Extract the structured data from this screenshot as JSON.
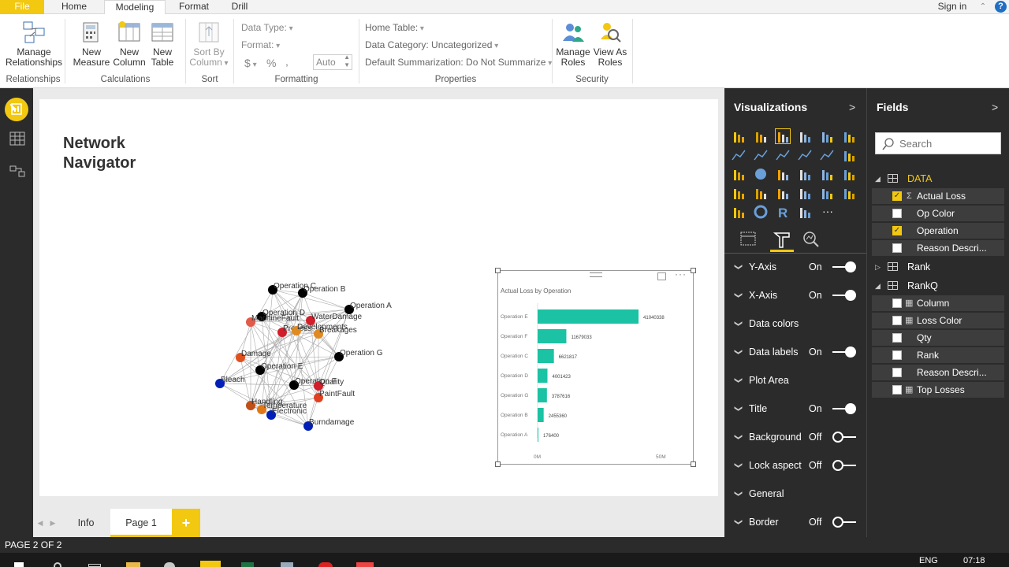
{
  "ribbon": {
    "tabs": [
      "File",
      "Home",
      "Modeling",
      "Format",
      "Drill"
    ],
    "signin": "Sign in",
    "help": "?",
    "buttons": {
      "manage_rel": "Manage Relationships",
      "new_measure": "New Measure",
      "new_column": "New Column",
      "new_table": "New Table",
      "sort_by_column": "Sort By Column",
      "manage_roles": "Manage Roles",
      "view_as_roles": "View As Roles"
    },
    "formatting": {
      "data_type": "Data Type:",
      "format": "Format:",
      "currency": "$",
      "percent": "%",
      "comma": ",",
      "auto": "Auto"
    },
    "properties": {
      "home_table": "Home Table:",
      "data_category": "Data Category: Uncategorized",
      "default_summarization": "Default Summarization: Do Not Summarize"
    },
    "groups": [
      "Relationships",
      "Calculations",
      "Sort",
      "Formatting",
      "Properties",
      "Security"
    ]
  },
  "report": {
    "title": "Network Navigator",
    "chart_title": "Actual Loss by Operation",
    "network_labels": [
      "Operation C",
      "Operation B",
      "Operation A",
      "Operation D",
      "MachineFault",
      "WaterDamage",
      "Process",
      "Developments",
      "Breakages",
      "Damage",
      "Operation G",
      "Operation E",
      "Bleach",
      "Operation F",
      "Quality",
      "PaintFault",
      "Handling",
      "Temperature",
      "Electronic",
      "Burndamage"
    ]
  },
  "chart_data": {
    "type": "bar",
    "title": "Actual Loss by Operation",
    "orientation": "horizontal",
    "categories": [
      "Operation E",
      "Operation F",
      "Operation C",
      "Operation D",
      "Operation G",
      "Operation B",
      "Operation A"
    ],
    "values": [
      41040338,
      11679033,
      6621817,
      4001423,
      3787616,
      2455360,
      176400
    ],
    "data_labels": [
      "41040338",
      "11679033",
      "6621817",
      "4001423",
      "3787616",
      "2455360",
      "176400"
    ],
    "x_ticks": [
      "0M",
      "50M"
    ],
    "xlim": [
      0,
      50000000
    ],
    "color": "#1bc2a3"
  },
  "page_tabs": {
    "info": "Info",
    "page1": "Page 1",
    "add": "+"
  },
  "status": "PAGE 2 OF 2",
  "taskbar": {
    "lang": "ENG",
    "time": "07:18"
  },
  "visualizations": {
    "header": "Visualizations",
    "more": "···",
    "props": [
      {
        "label": "Y-Axis",
        "value": "On",
        "toggle": true
      },
      {
        "label": "X-Axis",
        "value": "On",
        "toggle": true
      },
      {
        "label": "Data colors",
        "value": "",
        "toggle": null
      },
      {
        "label": "Data labels",
        "value": "On",
        "toggle": true
      },
      {
        "label": "Plot Area",
        "value": "",
        "toggle": null
      },
      {
        "label": "Title",
        "value": "On",
        "toggle": true
      },
      {
        "label": "Background",
        "value": "Off",
        "toggle": false
      },
      {
        "label": "Lock aspect",
        "value": "Off",
        "toggle": false
      },
      {
        "label": "General",
        "value": "",
        "toggle": null
      },
      {
        "label": "Border",
        "value": "Off",
        "toggle": false
      }
    ]
  },
  "fields": {
    "header": "Fields",
    "search_placeholder": "Search",
    "tables": [
      {
        "name": "DATA",
        "expanded": true,
        "highlight": true,
        "fields": [
          {
            "name": "Actual Loss",
            "checked": true,
            "sigma": true
          },
          {
            "name": "Op Color",
            "checked": false
          },
          {
            "name": "Operation",
            "checked": true
          },
          {
            "name": "Reason Descri...",
            "checked": false
          }
        ]
      },
      {
        "name": "Rank",
        "expanded": false,
        "fields": []
      },
      {
        "name": "RankQ",
        "expanded": true,
        "fields": [
          {
            "name": "Column",
            "checked": false,
            "calc": true
          },
          {
            "name": "Loss Color",
            "checked": false,
            "calc": true
          },
          {
            "name": "Qty",
            "checked": false
          },
          {
            "name": "Rank",
            "checked": false
          },
          {
            "name": "Reason Descri...",
            "checked": false
          },
          {
            "name": "Top Losses",
            "checked": false,
            "calc": true
          }
        ]
      }
    ]
  }
}
